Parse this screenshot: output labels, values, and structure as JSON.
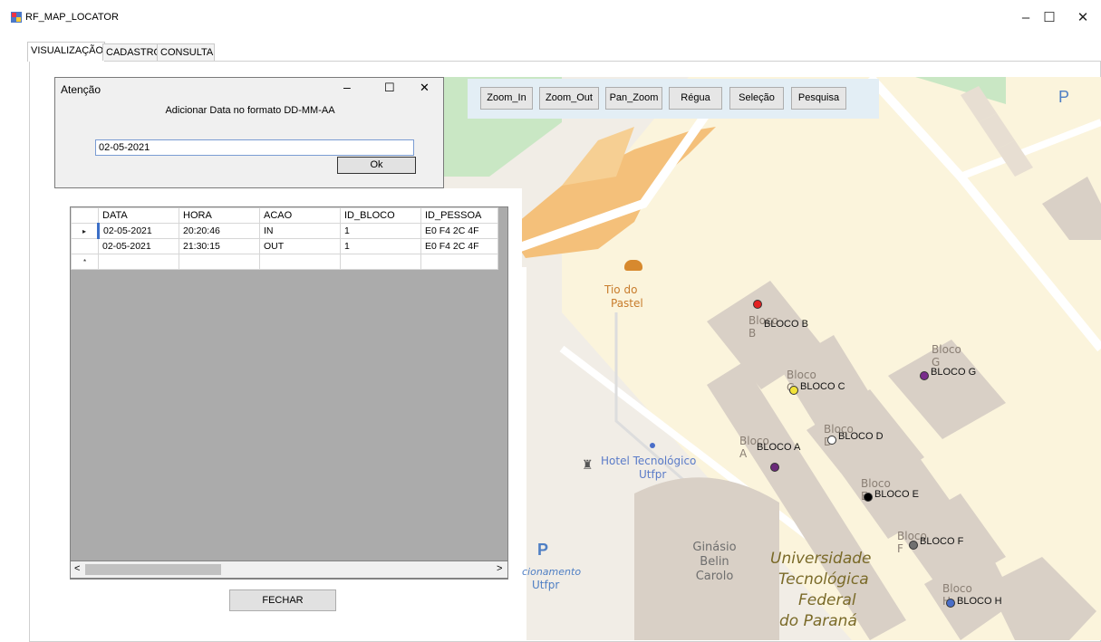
{
  "window": {
    "title": "RF_MAP_LOCATOR",
    "controls": {
      "minimize": "–",
      "maximize": "☐",
      "close": "✕"
    }
  },
  "tabs": [
    {
      "label": "VISUALIZAÇÃO",
      "active": true
    },
    {
      "label": "CADASTRO",
      "active": false
    },
    {
      "label": "CONSULTA",
      "active": false
    }
  ],
  "toolbar": {
    "zoom_in": "Zoom_In",
    "zoom_out": "Zoom_Out",
    "pan_zoom": "Pan_Zoom",
    "regua": "Régua",
    "selecao": "Seleção",
    "pesquisa": "Pesquisa"
  },
  "dialog": {
    "title": "Atenção",
    "prompt": "Adicionar Data no formato DD-MM-AA",
    "input_value": "02-05-2021",
    "ok_label": "Ok",
    "controls": {
      "minimize": "–",
      "maximize": "☐",
      "close": "✕"
    }
  },
  "grid": {
    "columns": [
      "DATA",
      "HORA",
      "ACAO",
      "ID_BLOCO",
      "ID_PESSOA"
    ],
    "rows": [
      [
        "02-05-2021",
        "20:20:46",
        "IN",
        "1",
        "E0 F4 2C 4F"
      ],
      [
        "02-05-2021",
        "21:30:15",
        "OUT",
        "1",
        "E0 F4 2C 4F"
      ]
    ],
    "current_row_marker": "▸",
    "new_row_marker": "*",
    "scroll_left": "<",
    "scroll_right": ">"
  },
  "fechar_label": "FECHAR",
  "map": {
    "labels": {
      "tio_do_pastel_1": "Tio do",
      "tio_do_pastel_2": "Pastel",
      "hotel_1": "Hotel Tecnológico",
      "hotel_2": "Utfpr",
      "ginasio_1": "Ginásio",
      "ginasio_2": "Belin",
      "ginasio_3": "Carolo",
      "utfpr_1": "Universidade",
      "utfpr_2": "Tecnológica",
      "utfpr_3": "Federal",
      "utfpr_4": "do Paraná",
      "estacionamento_1": "cionamento",
      "estacionamento_2": "Utfpr",
      "parking": "P",
      "bloco_a_map": "Bloco A",
      "bloco_b_map": "Bloco B",
      "bloco_c_map": "Bloco C",
      "bloco_d_map": "Bloco D",
      "bloco_e_map": "Bloco E",
      "bloco_f_map": "Bloco F",
      "bloco_g_map": "Bloco G",
      "bloco_h_map": "Bloco H"
    },
    "markers": [
      {
        "label": "BLOCO A",
        "color": "#6b2a7a"
      },
      {
        "label": "BLOCO B",
        "color": "#e32222"
      },
      {
        "label": "BLOCO C",
        "color": "#f2e33a"
      },
      {
        "label": "BLOCO D",
        "color": "#ffffff"
      },
      {
        "label": "BLOCO E",
        "color": "#000000"
      },
      {
        "label": "BLOCO F",
        "color": "#707070"
      },
      {
        "label": "BLOCO G",
        "color": "#7a2d8c"
      },
      {
        "label": "BLOCO H",
        "color": "#4a6ec8"
      }
    ]
  }
}
